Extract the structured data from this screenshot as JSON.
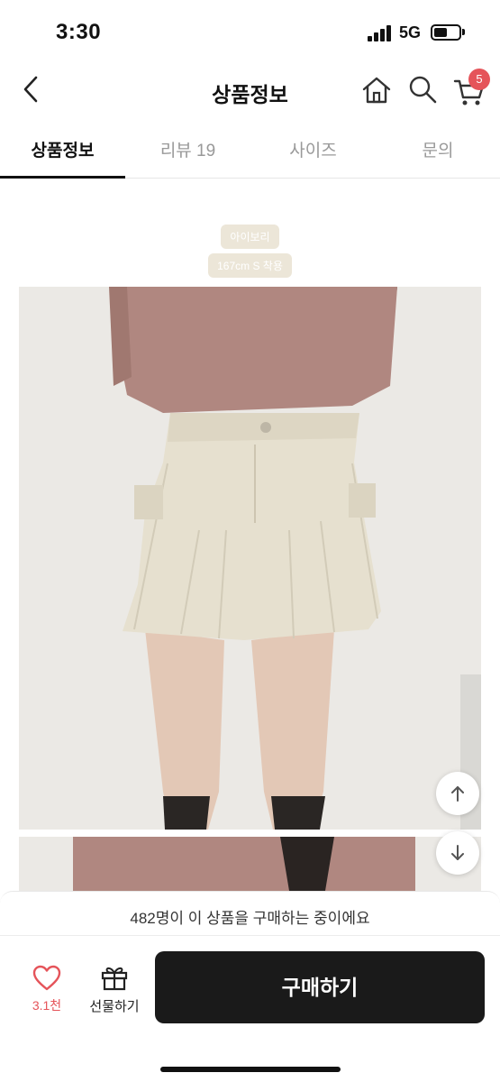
{
  "status": {
    "time": "3:30",
    "network": "5G"
  },
  "nav": {
    "title": "상품정보",
    "cart_count": "5"
  },
  "tabs": [
    {
      "label": "상품정보"
    },
    {
      "label": "리뷰 19"
    },
    {
      "label": "사이즈"
    },
    {
      "label": "문의"
    }
  ],
  "options": {
    "color": "아이보리",
    "size_note": "167cm S 착용"
  },
  "viewer_text": "482명이 이 상품을 구매하는 중이에요",
  "actions": {
    "like_count": "3.1천",
    "gift_label": "선물하기",
    "buy_label": "구매하기"
  },
  "colors": {
    "accent": "#e5545a",
    "buy_button": "#1a1a1a",
    "chip": "#ece6d8"
  }
}
